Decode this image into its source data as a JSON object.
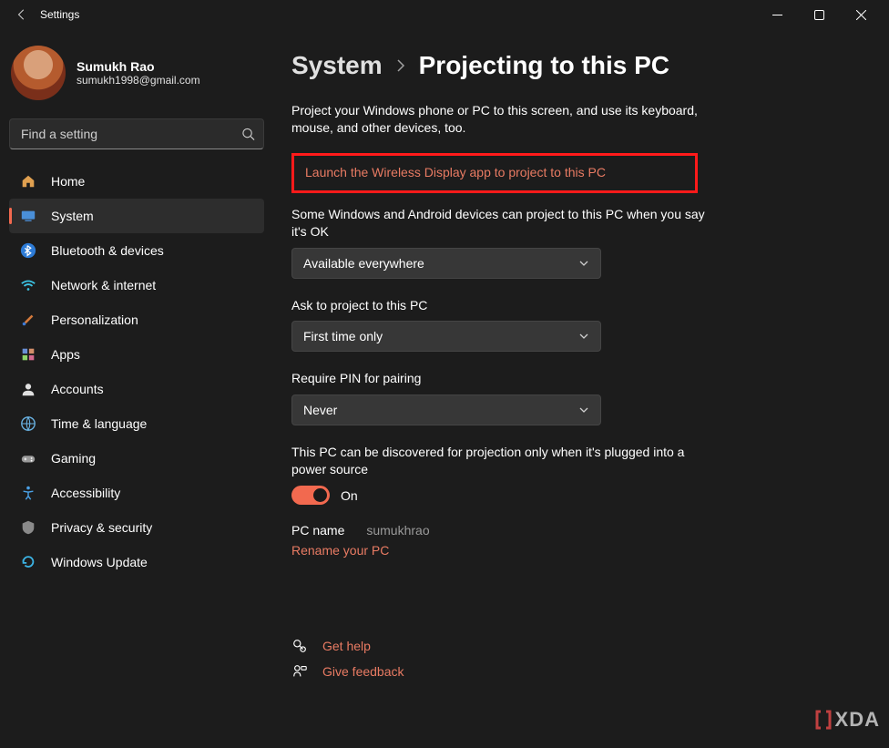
{
  "titlebar": {
    "title": "Settings"
  },
  "user": {
    "name": "Sumukh Rao",
    "email": "sumukh1998@gmail.com"
  },
  "search": {
    "placeholder": "Find a setting"
  },
  "sidebar": {
    "items": [
      {
        "label": "Home",
        "icon": "home"
      },
      {
        "label": "System",
        "icon": "system",
        "active": true
      },
      {
        "label": "Bluetooth & devices",
        "icon": "bluetooth"
      },
      {
        "label": "Network & internet",
        "icon": "wifi"
      },
      {
        "label": "Personalization",
        "icon": "brush"
      },
      {
        "label": "Apps",
        "icon": "apps"
      },
      {
        "label": "Accounts",
        "icon": "person"
      },
      {
        "label": "Time & language",
        "icon": "globe"
      },
      {
        "label": "Gaming",
        "icon": "gamepad"
      },
      {
        "label": "Accessibility",
        "icon": "accessibility"
      },
      {
        "label": "Privacy & security",
        "icon": "shield"
      },
      {
        "label": "Windows Update",
        "icon": "update"
      }
    ]
  },
  "breadcrumb": {
    "parent": "System",
    "current": "Projecting to this PC"
  },
  "main": {
    "description": "Project your Windows phone or PC to this screen, and use its keyboard, mouse, and other devices, too.",
    "launch_link": "Launch the Wireless Display app to project to this PC",
    "settings": {
      "project_permission": {
        "label": "Some Windows and Android devices can project to this PC when you say it's OK",
        "value": "Available everywhere"
      },
      "ask_to_project": {
        "label": "Ask to project to this PC",
        "value": "First time only"
      },
      "require_pin": {
        "label": "Require PIN for pairing",
        "value": "Never"
      },
      "discovery": {
        "label": "This PC can be discovered for projection only when it's plugged into a power source",
        "state": "On"
      }
    },
    "pcname": {
      "label": "PC name",
      "value": "sumukhrao"
    },
    "rename_link": "Rename your PC",
    "help_link": "Get help",
    "feedback_link": "Give feedback"
  },
  "watermark": "XDA"
}
